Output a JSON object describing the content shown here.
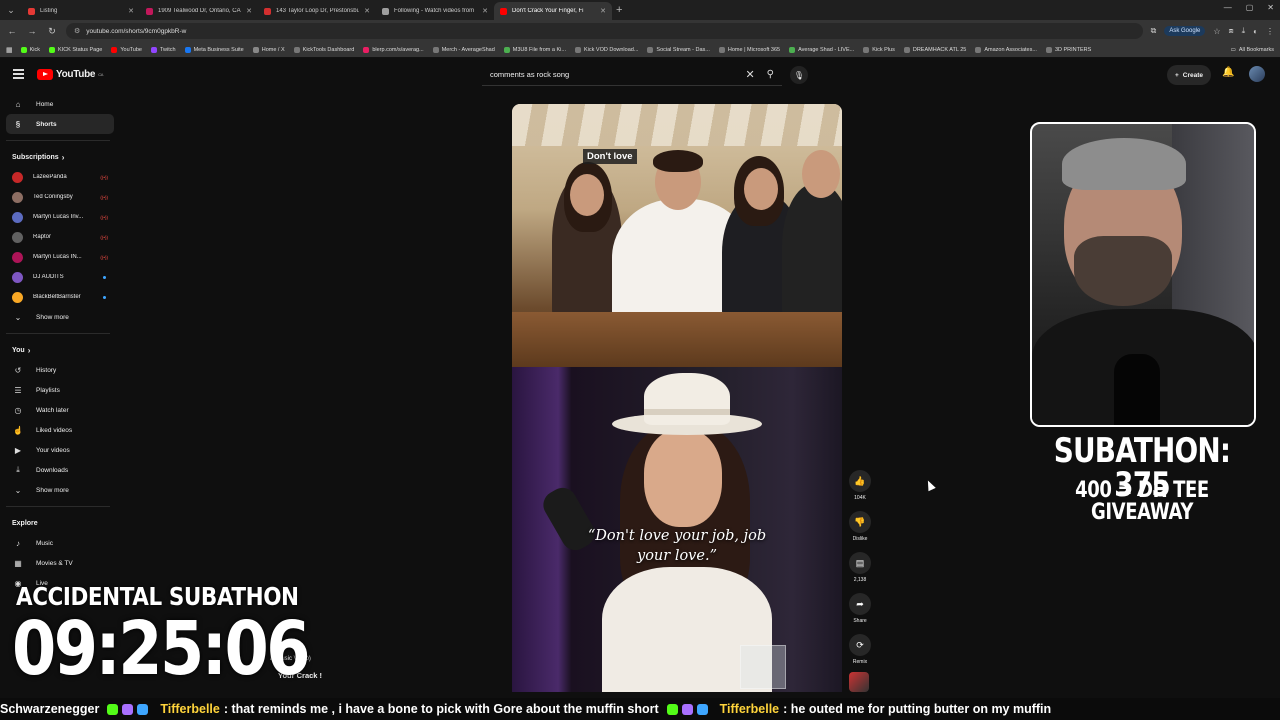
{
  "browser": {
    "tabs": [
      {
        "title": "Listing",
        "color": "#e53935",
        "active": false
      },
      {
        "title": "1909 Tealwood Dr, Ontario, CA",
        "color": "#c2185b",
        "active": false
      },
      {
        "title": "143 Taylor Loop Dr, Prestonsburg",
        "color": "#d32f2f",
        "active": false
      },
      {
        "title": "Following - Watch videos from",
        "color": "#9e9e9e",
        "active": false
      },
      {
        "title": "Don't Crack Your Finger, Fi",
        "color": "#ff0000",
        "active": true
      }
    ],
    "url": "youtube.com/shorts/9cm0gpkbR-w",
    "ask_google": "Ask Google",
    "bookmarks": [
      {
        "label": "Kick",
        "color": "#53fc18"
      },
      {
        "label": "KICK Status Page",
        "color": "#53fc18"
      },
      {
        "label": "YouTube",
        "color": "#ff0000"
      },
      {
        "label": "Twitch",
        "color": "#9146ff"
      },
      {
        "label": "Meta Business Suite",
        "color": "#1877f2"
      },
      {
        "label": "Home / X",
        "color": "#888888"
      },
      {
        "label": "KickTools Dashboard",
        "color": "#777777"
      },
      {
        "label": "blerp.com/s/averag...",
        "color": "#e91e63"
      },
      {
        "label": "Merch - AverageShad",
        "color": "#777777"
      },
      {
        "label": "M3U8 File from a Ki...",
        "color": "#4caf50"
      },
      {
        "label": "Kick VOD Download...",
        "color": "#777777"
      },
      {
        "label": "Social Stream - Das...",
        "color": "#777777"
      },
      {
        "label": "Home | Microsoft 365",
        "color": "#777777"
      },
      {
        "label": "Average Shad - LIVE...",
        "color": "#4caf50"
      },
      {
        "label": "Kick Plus",
        "color": "#777777"
      },
      {
        "label": "DREAMHACK ATL 25",
        "color": "#777777"
      },
      {
        "label": "Amazon Associates...",
        "color": "#777777"
      },
      {
        "label": "3D PRINTERS",
        "color": "#777777"
      }
    ],
    "all_bookmarks": "All Bookmarks"
  },
  "header": {
    "logo_text": "YouTube",
    "logo_region": "CA",
    "search_value": "comments as rock song",
    "create_label": "Create"
  },
  "sidebar": {
    "main": [
      {
        "label": "Home",
        "icon": "⌂"
      },
      {
        "label": "Shorts",
        "icon": "§"
      }
    ],
    "subscriptions_title": "Subscriptions",
    "subscriptions": [
      {
        "name": "LazeePanda",
        "status": "live",
        "color": "#c62828"
      },
      {
        "name": "Ted Coningsby",
        "status": "live",
        "color": "#8d6e63"
      },
      {
        "name": "Martyn Lucas Inv...",
        "status": "live",
        "color": "#5c6bc0"
      },
      {
        "name": "Raptor",
        "status": "live",
        "color": "#616161"
      },
      {
        "name": "Martyn Lucas IN...",
        "status": "live",
        "color": "#ad1457"
      },
      {
        "name": "DJ AUDITS",
        "status": "dot",
        "color": "#7e57c2"
      },
      {
        "name": "BlackBeltBarrister",
        "status": "dot",
        "color": "#f9a825"
      }
    ],
    "show_more": "Show more",
    "you_title": "You",
    "you_items": [
      {
        "label": "History",
        "icon": "↺"
      },
      {
        "label": "Playlists",
        "icon": "☰"
      },
      {
        "label": "Watch later",
        "icon": "◷"
      },
      {
        "label": "Liked videos",
        "icon": "☝"
      },
      {
        "label": "Your videos",
        "icon": "▶"
      },
      {
        "label": "Downloads",
        "icon": "⤓"
      }
    ],
    "show_more_2": "Show more",
    "explore_title": "Explore",
    "explore_items": [
      {
        "label": "Music",
        "icon": "♪"
      },
      {
        "label": "Movies & TV",
        "icon": "▦"
      },
      {
        "label": "Live",
        "icon": "◉"
      }
    ]
  },
  "video": {
    "caption_top": "Don't love",
    "quote": "“Don't love your job, job your love.”"
  },
  "actions": {
    "like_count": "104K",
    "dislike_label": "Dislike",
    "comments_count": "2,138",
    "share_label": "Share",
    "remix_label": "Remix"
  },
  "overlay": {
    "subathon": "SUBATHON: 375",
    "goal": "400 = DH TEE GIVEAWAY",
    "accidental_title": "ACCIDENTAL SUBATHON",
    "timer": "09:25:06",
    "peek_1": "al Music Video)",
    "peek_2": "Your Crack !"
  },
  "ticker": {
    "lead_text": "Schwarzenegger",
    "user_1": "Tifferbelle",
    "msg_1": ":  that reminds me , i have a bone to pick with Gore about the muffin short",
    "user_2": "Tifferbelle",
    "msg_2": ":  he outed me for putting butter on my muffin"
  }
}
